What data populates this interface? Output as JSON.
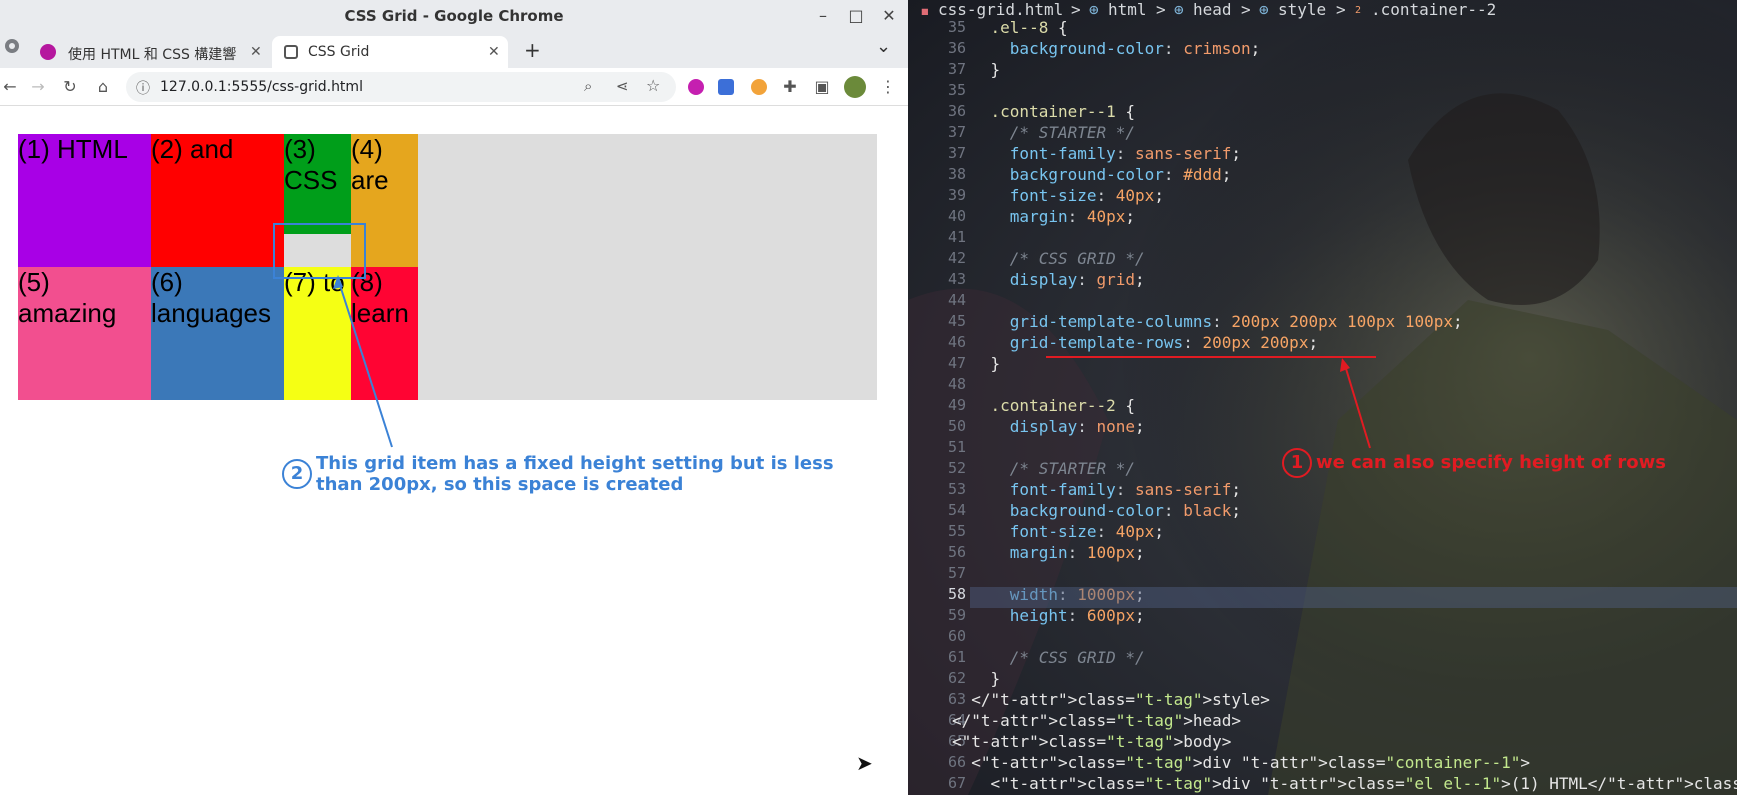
{
  "browser": {
    "window_title": "CSS Grid - Google Chrome",
    "tabs": [
      {
        "label": "使用 HTML 和 CSS 構建響",
        "active": false
      },
      {
        "label": "CSS Grid",
        "active": true
      }
    ],
    "url": "127.0.0.1:5555/css-grid.html",
    "controls": {
      "minimize": "–",
      "maximize": "□",
      "close": "✕",
      "new_tab": "+",
      "tab_menu": "⌄",
      "tab_close": "✕"
    }
  },
  "page": {
    "grid_items": [
      {
        "label": "(1) HTML",
        "color": "#a800e6"
      },
      {
        "label": "(2) and",
        "color": "#ff0000"
      },
      {
        "label": "(3) CSS",
        "color": "#009e1a"
      },
      {
        "label": "(4) are",
        "color": "#e5a61e"
      },
      {
        "label": "(5) amazing",
        "color": "#f24f8f"
      },
      {
        "label": "(6) languages",
        "color": "#3b78b8"
      },
      {
        "label": "(7) to",
        "color": "#f5ff14"
      },
      {
        "label": "(8) learn",
        "color": "#ff0433"
      }
    ],
    "annotation": {
      "number": "2",
      "text": "This grid item has a fixed height setting but is less than 200px, so this space is created",
      "color": "#3b82d6"
    }
  },
  "editor": {
    "breadcrumb": {
      "file": "css-grid.html",
      "items": [
        "html",
        "head",
        "style"
      ],
      "selector_num": "2",
      "selector": ".container--2",
      "sep": ">"
    },
    "lines": [
      {
        "n": "35",
        "code": "    .el--8 {"
      },
      {
        "n": "36",
        "code": "      background-color: crimson;"
      },
      {
        "n": "37",
        "code": "    }"
      },
      {
        "n": "35",
        "code": ""
      },
      {
        "n": "36",
        "code": "    .container--1 {"
      },
      {
        "n": "37",
        "code": "      /* STARTER */"
      },
      {
        "n": "37",
        "code": "      font-family: sans-serif;"
      },
      {
        "n": "38",
        "code": "      background-color: #ddd;"
      },
      {
        "n": "39",
        "code": "      font-size: 40px;"
      },
      {
        "n": "40",
        "code": "      margin: 40px;"
      },
      {
        "n": "41",
        "code": ""
      },
      {
        "n": "42",
        "code": "      /* CSS GRID */"
      },
      {
        "n": "43",
        "code": "      display: grid;"
      },
      {
        "n": "44",
        "code": ""
      },
      {
        "n": "45",
        "code": "      grid-template-columns: 200px 200px 100px 100px;"
      },
      {
        "n": "46",
        "code": "      grid-template-rows: 200px 200px;"
      },
      {
        "n": "47",
        "code": "    }"
      },
      {
        "n": "48",
        "code": ""
      },
      {
        "n": "49",
        "code": "    .container--2 {"
      },
      {
        "n": "50",
        "code": "      display: none;"
      },
      {
        "n": "51",
        "code": ""
      },
      {
        "n": "52",
        "code": "      /* STARTER */"
      },
      {
        "n": "53",
        "code": "      font-family: sans-serif;"
      },
      {
        "n": "54",
        "code": "      background-color: black;"
      },
      {
        "n": "55",
        "code": "      font-size: 40px;"
      },
      {
        "n": "56",
        "code": "      margin: 100px;"
      },
      {
        "n": "57",
        "code": ""
      },
      {
        "n": "58",
        "code": "      width: 1000px;",
        "current": true
      },
      {
        "n": "59",
        "code": "      height: 600px;"
      },
      {
        "n": "60",
        "code": ""
      },
      {
        "n": "61",
        "code": "      /* CSS GRID */"
      },
      {
        "n": "62",
        "code": "    }"
      },
      {
        "n": "63",
        "code": "  </style>"
      },
      {
        "n": "64",
        "code": "</head>"
      },
      {
        "n": "65",
        "code": "<body>"
      },
      {
        "n": "66",
        "code": "  <div class=\"container--1\">"
      },
      {
        "n": "67",
        "code": "    <div class=\"el el--1\">(1) HTML</div>"
      }
    ],
    "annotation": {
      "number": "1",
      "text": "we can also specify height of rows",
      "color": "#e11b22"
    }
  }
}
